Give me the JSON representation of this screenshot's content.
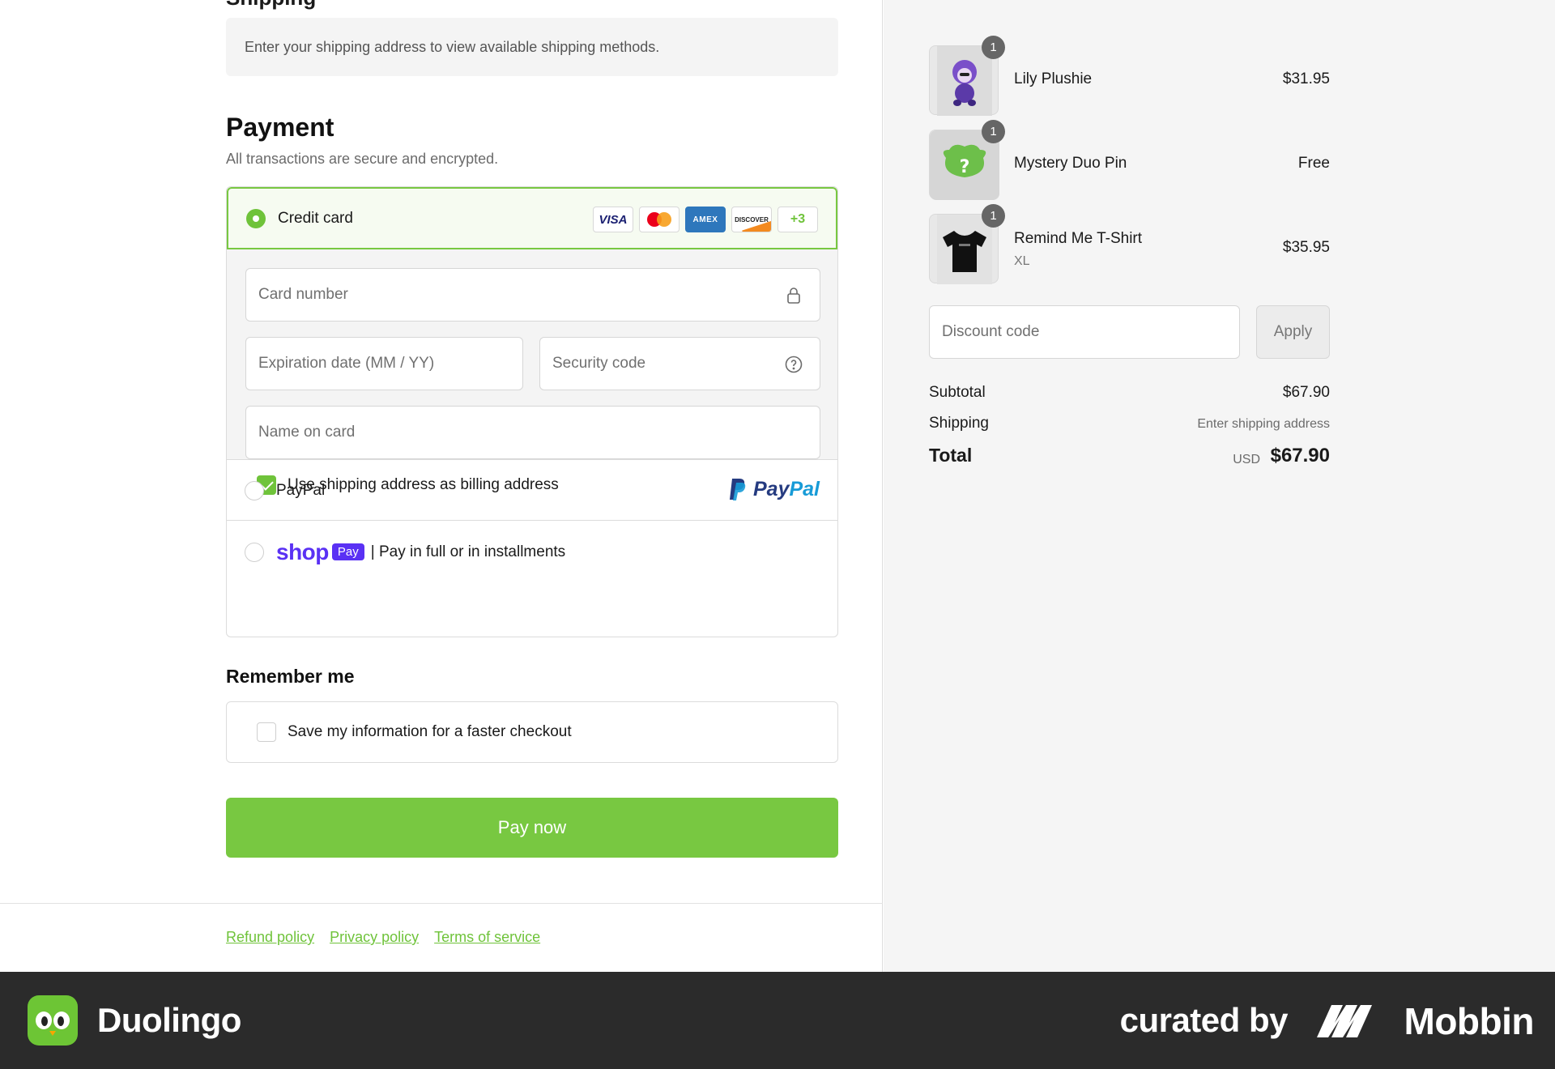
{
  "shipping": {
    "heading": "Shipping",
    "info": "Enter your shipping address to view available shipping methods."
  },
  "payment": {
    "title": "Payment",
    "subtitle": "All transactions are secure and encrypted.",
    "credit_card": {
      "label": "Credit card",
      "selected": true,
      "card_brands": [
        "VISA",
        "mastercard",
        "AMEX",
        "DISCOVER"
      ],
      "more_label": "+3",
      "fields": {
        "card_number": "Card number",
        "expiration": "Expiration date (MM / YY)",
        "security_code": "Security code",
        "name_on_card": "Name on card"
      },
      "billing_checkbox": {
        "label": "Use shipping address as billing address",
        "checked": true
      }
    },
    "paypal": {
      "label": "PayPal",
      "logo_part1": "Pay",
      "logo_part2": "Pal"
    },
    "shop_pay": {
      "word": "shop",
      "badge": "Pay",
      "label": "| Pay in full or in installments"
    }
  },
  "remember": {
    "title": "Remember me",
    "label": "Save my information for a faster checkout",
    "checked": false
  },
  "pay_button": "Pay now",
  "policies": [
    "Refund policy",
    "Privacy policy",
    "Terms of service"
  ],
  "cart": {
    "items": [
      {
        "name": "Lily Plushie",
        "variant": "",
        "price": "$31.95",
        "qty": "1"
      },
      {
        "name": "Mystery Duo Pin",
        "variant": "",
        "price": "Free",
        "qty": "1"
      },
      {
        "name": "Remind Me T-Shirt",
        "variant": "XL",
        "price": "$35.95",
        "qty": "1"
      }
    ],
    "discount_placeholder": "Discount code",
    "apply_label": "Apply",
    "subtotal_label": "Subtotal",
    "subtotal_value": "$67.90",
    "shipping_label": "Shipping",
    "shipping_value": "Enter shipping address",
    "total_label": "Total",
    "currency": "USD",
    "total_value": "$67.90"
  },
  "branding": {
    "app_name": "Duolingo",
    "curated_by": "curated by",
    "curator": "Mobbin"
  },
  "colors": {
    "accent": "#78c841",
    "shop_pay": "#5a31f4",
    "paypal_dark": "#253b80",
    "paypal_light": "#179bd7",
    "bottom_bar": "#2b2b2b"
  }
}
